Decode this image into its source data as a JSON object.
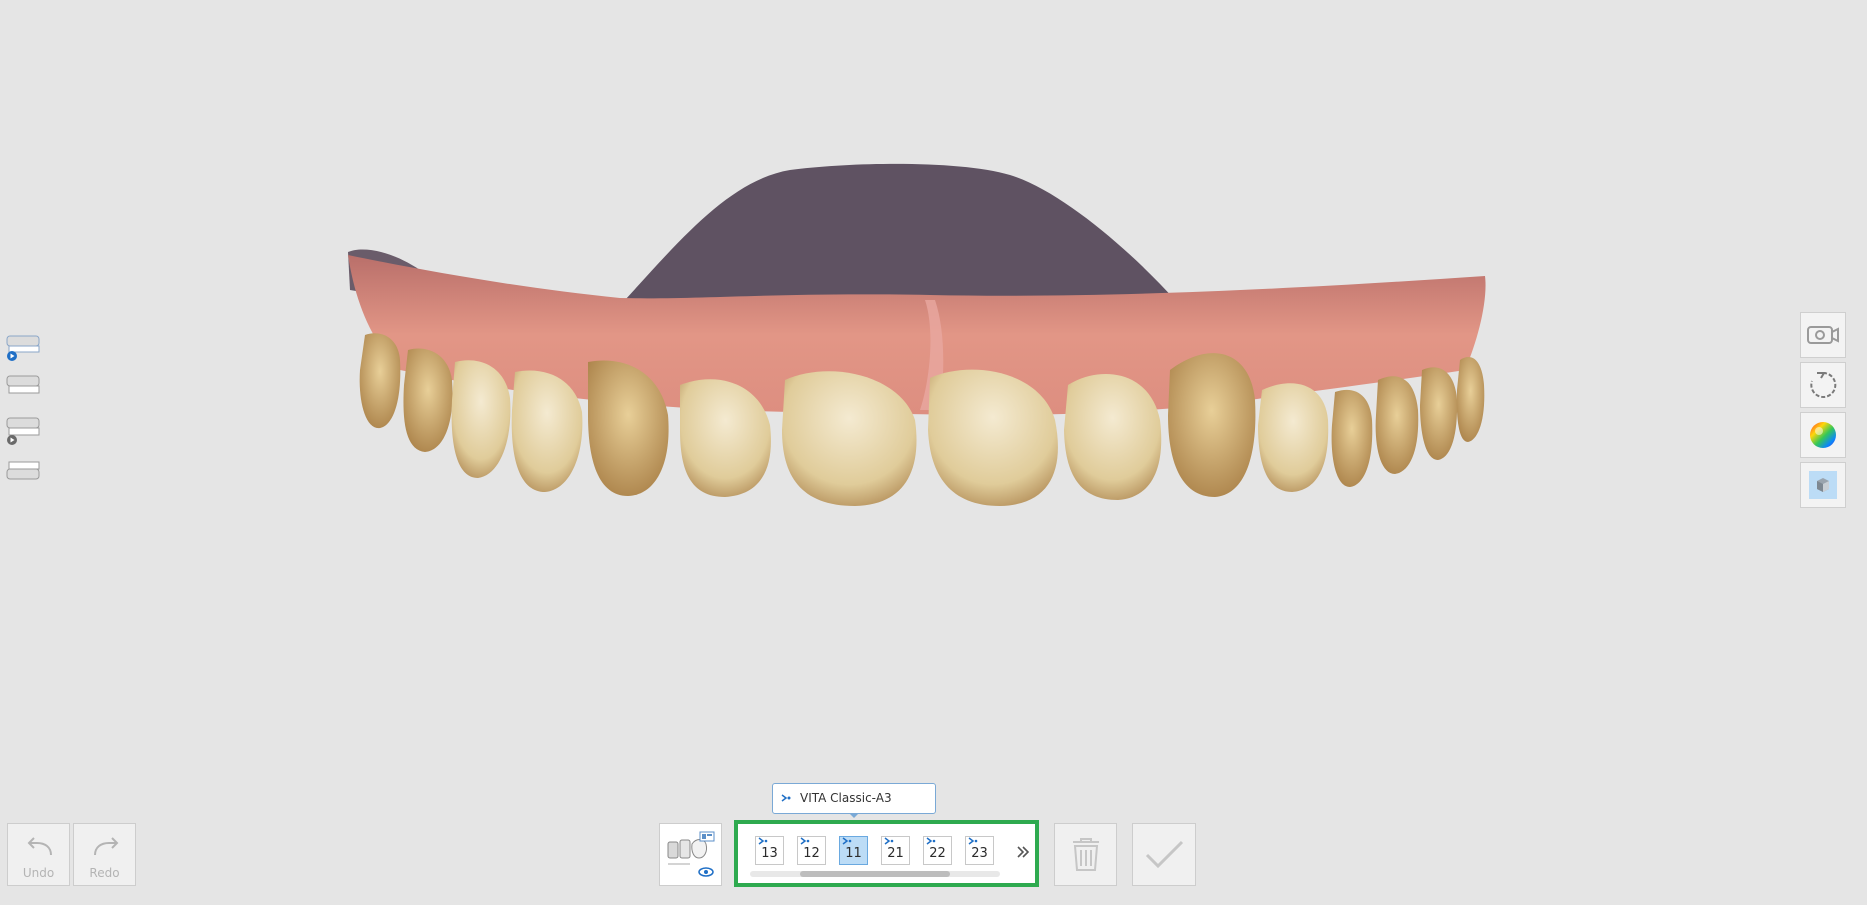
{
  "history": {
    "undo_label": "Undo",
    "redo_label": "Redo"
  },
  "shade_tooltip": {
    "text": "VITA Classic-A3"
  },
  "teeth": [
    "13",
    "12",
    "11",
    "21",
    "22",
    "23"
  ],
  "selected_tooth": "11",
  "colors": {
    "background": "#e5e5e5",
    "panel_highlight": "#2eaa4f",
    "active_tooth": "#bcdcf6",
    "accent": "#1f6fc6",
    "gingiva": "#d88a7a",
    "palate": "#5f5262",
    "tooth": "#e6d4a8"
  },
  "icons": {
    "left_toolbar": [
      "upper-jaw-active-icon",
      "upper-jaw-icon",
      "upper-jaw-prep-icon",
      "lower-jaw-icon"
    ],
    "right_toolbar": [
      "camera-icon",
      "rotate-reset-icon",
      "color-map-icon",
      "view-cube-icon"
    ]
  }
}
